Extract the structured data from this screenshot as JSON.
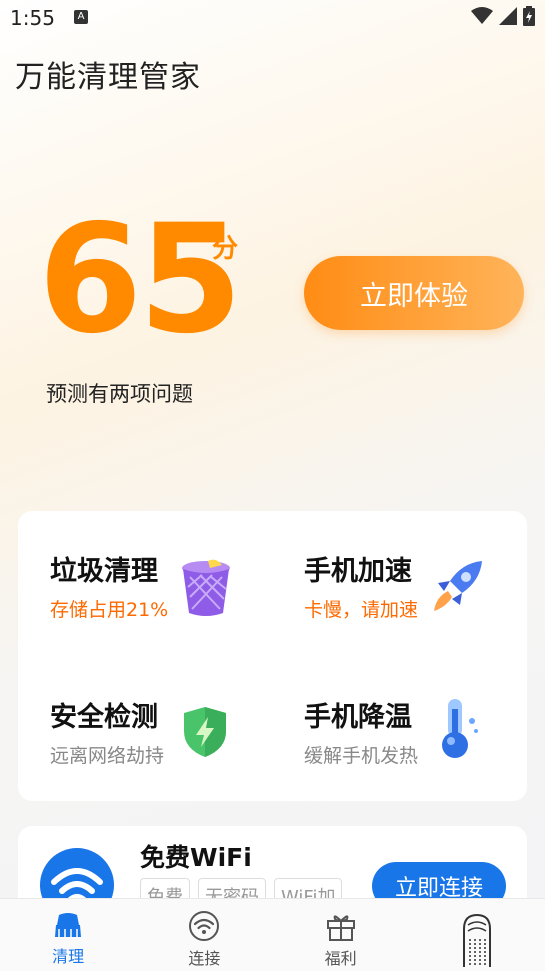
{
  "status_bar": {
    "time": "1:55",
    "notification_icon": "A"
  },
  "app": {
    "title": "万能清理管家"
  },
  "score": {
    "value": "65",
    "unit": "分",
    "description": "预测有两项问题",
    "action_label": "立即体验"
  },
  "tools": [
    {
      "title": "垃圾清理",
      "subtitle": "存储占用21%",
      "subtitle_color": "#ff6a00",
      "icon": "trash-bin-icon"
    },
    {
      "title": "手机加速",
      "subtitle": "卡慢，请加速",
      "subtitle_color": "#ff6a00",
      "icon": "rocket-icon"
    },
    {
      "title": "安全检测",
      "subtitle": "远离网络劫持",
      "subtitle_color": "#888888",
      "icon": "shield-icon"
    },
    {
      "title": "手机降温",
      "subtitle": "缓解手机发热",
      "subtitle_color": "#888888",
      "icon": "thermometer-icon"
    }
  ],
  "wifi": {
    "title": "免费WiFi",
    "tags": [
      "免费",
      "无密码",
      "WiFi加"
    ],
    "connect_label": "立即连接"
  },
  "nav": [
    {
      "label": "清理",
      "icon": "broom-icon",
      "active": true
    },
    {
      "label": "连接",
      "icon": "wifi-icon",
      "active": false
    },
    {
      "label": "福利",
      "icon": "gift-icon",
      "active": false
    },
    {
      "label": "",
      "icon": "mascot-icon",
      "active": false
    }
  ],
  "colors": {
    "accent_orange": "#ff8a00",
    "accent_blue": "#1976e8"
  }
}
